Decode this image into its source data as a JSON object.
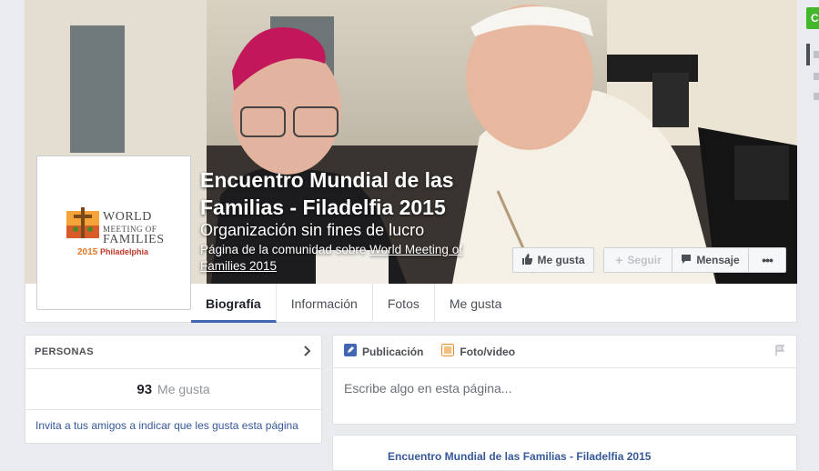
{
  "page": {
    "name": "Encuentro Mundial de las Familias - Filadelfia 2015",
    "category": "Organización sin fines de lucro",
    "community_prefix": "Página de la comunidad sobre",
    "community_link": "World Meeting of Families 2015"
  },
  "logo": {
    "line1": "WORLD",
    "line2": "MEETING OF",
    "line3": "FAMILIES",
    "year": "2015",
    "city": "Philadelphia"
  },
  "actions": {
    "like": "Me gusta",
    "follow": "Seguir",
    "message": "Mensaje",
    "more": "•••"
  },
  "tabs": [
    {
      "label": "Biografía",
      "active": true
    },
    {
      "label": "Información"
    },
    {
      "label": "Fotos"
    },
    {
      "label": "Me gusta"
    }
  ],
  "people": {
    "header": "PERSONAS",
    "likes_count": "93",
    "likes_label": "Me gusta",
    "invite_text": "Invita a tus amigos a indicar que les gusta esta página"
  },
  "composer": {
    "tab_post": "Publicación",
    "tab_photo": "Foto/video",
    "placeholder": "Escribe algo en esta página..."
  },
  "post": {
    "title": "Encuentro Mundial de las Familias - Filadelfia 2015"
  },
  "right_rail": {
    "button_glyph": "C"
  },
  "colors": {
    "accent": "#4267b2",
    "link": "#365899",
    "green": "#42b72a",
    "logo_orange": "#e27a26"
  }
}
